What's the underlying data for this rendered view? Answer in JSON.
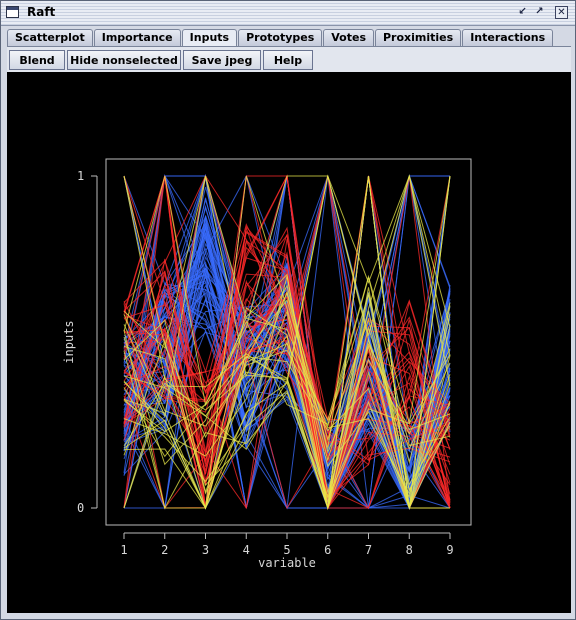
{
  "window": {
    "title": "Raft"
  },
  "titlebar_buttons": {
    "minimize": "↙",
    "maximize": "↗",
    "close": "✕"
  },
  "tabs": [
    {
      "label": "Scatterplot"
    },
    {
      "label": "Importance"
    },
    {
      "label": "Inputs"
    },
    {
      "label": "Prototypes"
    },
    {
      "label": "Votes"
    },
    {
      "label": "Proximities"
    },
    {
      "label": "Interactions"
    }
  ],
  "active_tab": "Inputs",
  "toolbar": {
    "blend": "Blend",
    "hide_nonselected": "Hide nonselected",
    "save_jpeg": "Save jpeg",
    "help": "Help"
  },
  "chart_data": {
    "type": "line",
    "subtype": "parallel-coordinates",
    "xlabel": "variable",
    "ylabel": "inputs",
    "x_ticks": [
      "1",
      "2",
      "3",
      "4",
      "5",
      "6",
      "7",
      "8",
      "9"
    ],
    "y_ticks": [
      "0",
      "1"
    ],
    "ylim": [
      0,
      1
    ],
    "background": "#000000",
    "series": [
      {
        "color": "#3a6cff",
        "profile": [
          0.3,
          0.45,
          0.75,
          0.4,
          0.55,
          0.05,
          0.45,
          0.05,
          0.45
        ],
        "count": 70
      },
      {
        "color": "#ff2a2a",
        "profile": [
          0.42,
          0.55,
          0.2,
          0.65,
          0.62,
          0.05,
          0.35,
          0.4,
          0.1
        ],
        "count": 40
      },
      {
        "color": "#e8e84a",
        "profile": [
          0.38,
          0.35,
          0.15,
          0.4,
          0.5,
          0.05,
          0.48,
          0.05,
          0.4
        ],
        "count": 25
      }
    ]
  }
}
